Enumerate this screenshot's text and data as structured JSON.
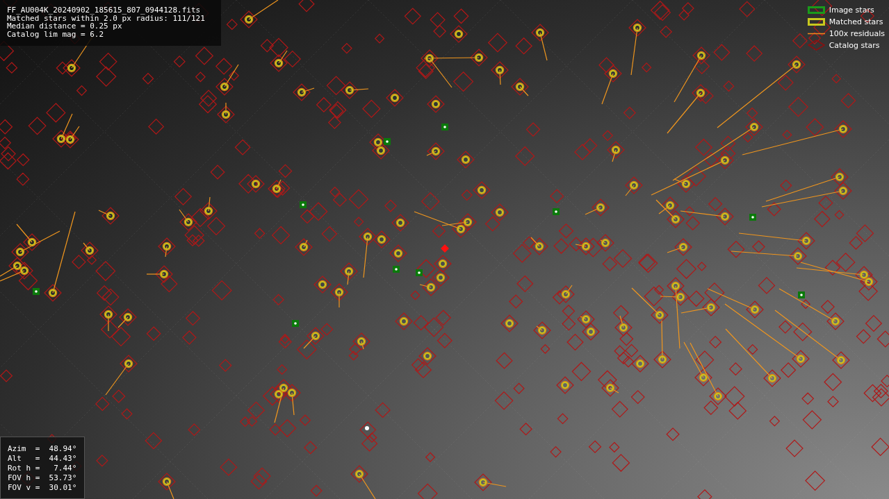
{
  "info_box": {
    "lines": [
      "FF_AU004K_20240902_185615_807_0944128.fits",
      "Matched stars within 2.0 px radius: 111/121",
      "Median distance = 0.25 px",
      "Catalog lim mag = 6.2"
    ]
  },
  "legend": [
    {
      "kind": "image",
      "label": "Image stars"
    },
    {
      "kind": "matched",
      "label": "Matched stars"
    },
    {
      "kind": "residual",
      "label": "100x residuals"
    },
    {
      "kind": "catalog",
      "label": "Catalog stars"
    }
  ],
  "pointing": {
    "lines": [
      "Azim  =  48.94°",
      "Alt   =  44.43°",
      "Rot h =   7.44°",
      "FOV h =  53.73°",
      "FOV v =  30.01°"
    ]
  }
}
